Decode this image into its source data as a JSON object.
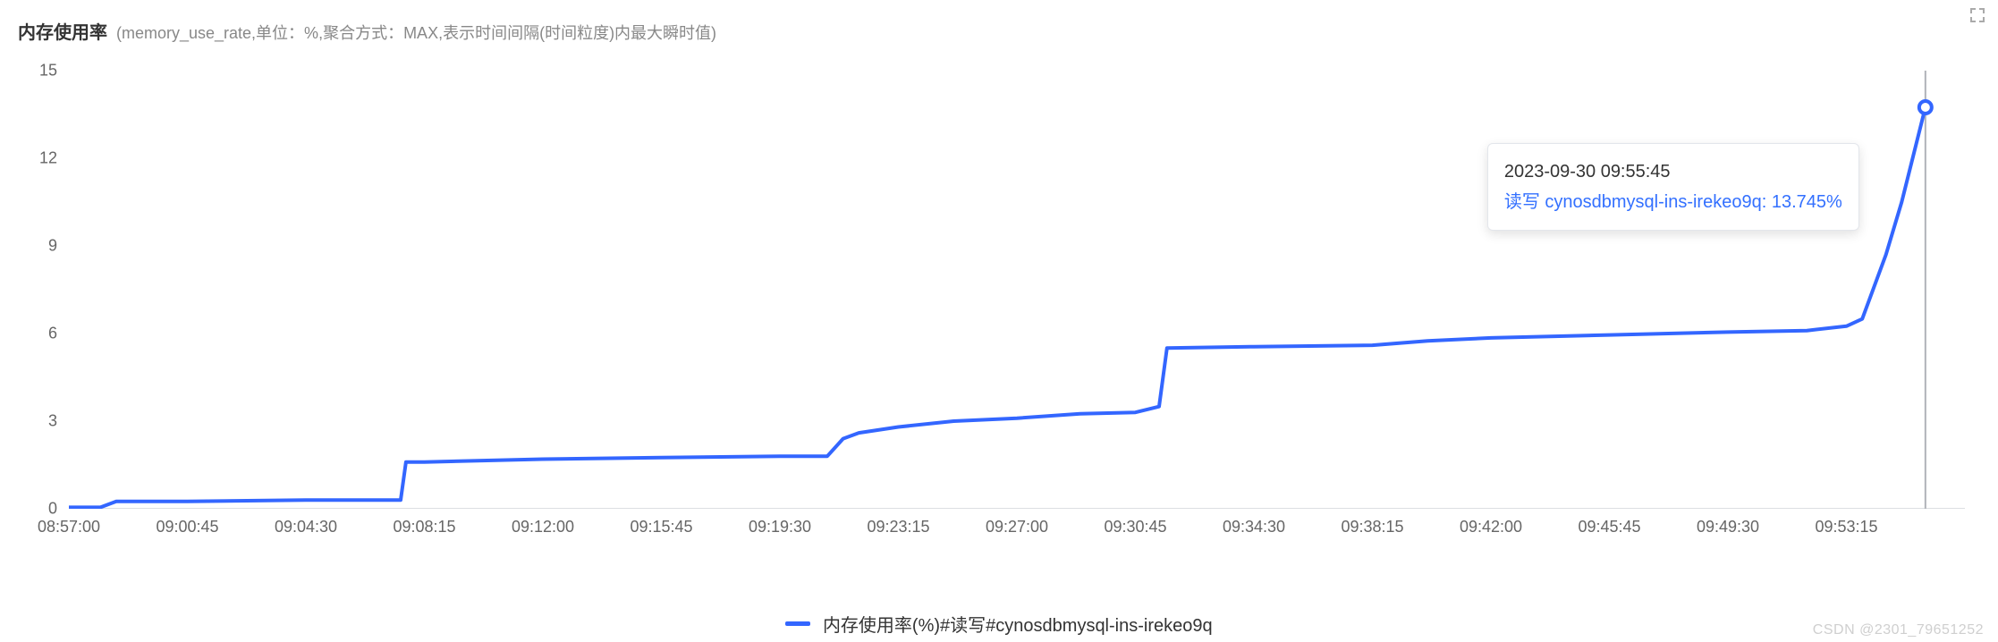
{
  "header": {
    "title": "内存使用率",
    "subtitle": "(memory_use_rate,单位：%,聚合方式：MAX,表示时间间隔(时间粒度)内最大瞬时值)"
  },
  "legend": {
    "label": "内存使用率(%)#读写#cynosdbmysql-ins-irekeo9q",
    "color": "#3366ff"
  },
  "tooltip": {
    "time": "2023-09-30 09:55:45",
    "series_label": "读写 cynosdbmysql-ins-irekeo9q: 13.745%"
  },
  "watermark": "CSDN @2301_79651252",
  "chart_data": {
    "type": "line",
    "title": "内存使用率 (memory_use_rate,单位：%,聚合方式：MAX)",
    "xlabel": "",
    "ylabel": "",
    "ylim": [
      0,
      15
    ],
    "y_ticks": [
      0,
      3,
      6,
      9,
      12,
      15
    ],
    "x_ticks": [
      "08:57:00",
      "09:00:45",
      "09:04:30",
      "09:08:15",
      "09:12:00",
      "09:15:45",
      "09:19:30",
      "09:23:15",
      "09:27:00",
      "09:30:45",
      "09:34:30",
      "09:38:15",
      "09:42:00",
      "09:45:45",
      "09:49:30",
      "09:53:15"
    ],
    "series": [
      {
        "name": "读写 cynosdbmysql-ins-irekeo9q",
        "color": "#3366ff",
        "data": [
          {
            "x": "08:57:00",
            "y": 0.05
          },
          {
            "x": "08:58:00",
            "y": 0.05
          },
          {
            "x": "08:58:30",
            "y": 0.25
          },
          {
            "x": "09:00:45",
            "y": 0.25
          },
          {
            "x": "09:04:30",
            "y": 0.3
          },
          {
            "x": "09:07:30",
            "y": 0.3
          },
          {
            "x": "09:07:40",
            "y": 1.6
          },
          {
            "x": "09:08:15",
            "y": 1.6
          },
          {
            "x": "09:12:00",
            "y": 1.7
          },
          {
            "x": "09:15:45",
            "y": 1.75
          },
          {
            "x": "09:19:30",
            "y": 1.8
          },
          {
            "x": "09:21:00",
            "y": 1.8
          },
          {
            "x": "09:21:30",
            "y": 2.4
          },
          {
            "x": "09:22:00",
            "y": 2.6
          },
          {
            "x": "09:23:15",
            "y": 2.8
          },
          {
            "x": "09:25:00",
            "y": 3.0
          },
          {
            "x": "09:27:00",
            "y": 3.1
          },
          {
            "x": "09:29:00",
            "y": 3.25
          },
          {
            "x": "09:30:45",
            "y": 3.3
          },
          {
            "x": "09:31:30",
            "y": 3.5
          },
          {
            "x": "09:31:45",
            "y": 5.5
          },
          {
            "x": "09:34:30",
            "y": 5.55
          },
          {
            "x": "09:38:15",
            "y": 5.6
          },
          {
            "x": "09:40:00",
            "y": 5.75
          },
          {
            "x": "09:42:00",
            "y": 5.85
          },
          {
            "x": "09:45:45",
            "y": 5.95
          },
          {
            "x": "09:49:30",
            "y": 6.05
          },
          {
            "x": "09:52:00",
            "y": 6.1
          },
          {
            "x": "09:53:15",
            "y": 6.25
          },
          {
            "x": "09:53:45",
            "y": 6.5
          },
          {
            "x": "09:54:30",
            "y": 8.7
          },
          {
            "x": "09:55:00",
            "y": 10.5
          },
          {
            "x": "09:55:45",
            "y": 13.745
          }
        ]
      }
    ],
    "hover_point": {
      "x": "09:55:45",
      "y": 13.745
    }
  }
}
